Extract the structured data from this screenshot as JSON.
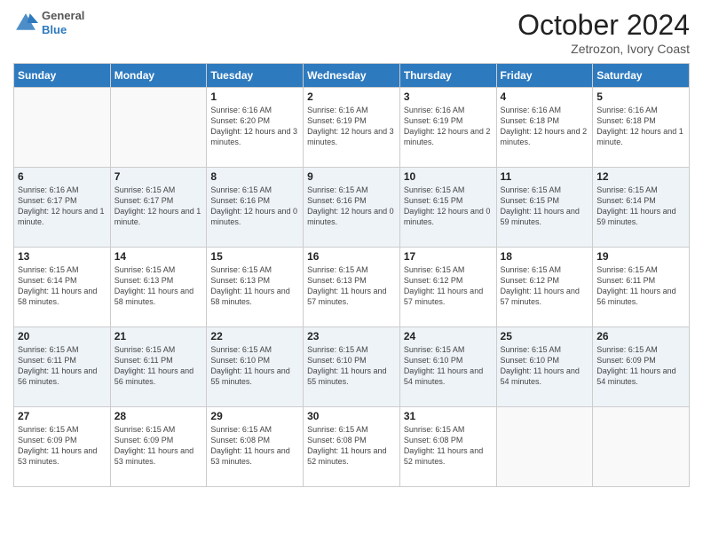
{
  "logo": {
    "line1": "General",
    "line2": "Blue"
  },
  "title": "October 2024",
  "subtitle": "Zetrozon, Ivory Coast",
  "weekdays": [
    "Sunday",
    "Monday",
    "Tuesday",
    "Wednesday",
    "Thursday",
    "Friday",
    "Saturday"
  ],
  "weeks": [
    [
      {
        "day": "",
        "info": ""
      },
      {
        "day": "",
        "info": ""
      },
      {
        "day": "1",
        "info": "Sunrise: 6:16 AM\nSunset: 6:20 PM\nDaylight: 12 hours and 3 minutes."
      },
      {
        "day": "2",
        "info": "Sunrise: 6:16 AM\nSunset: 6:19 PM\nDaylight: 12 hours and 3 minutes."
      },
      {
        "day": "3",
        "info": "Sunrise: 6:16 AM\nSunset: 6:19 PM\nDaylight: 12 hours and 2 minutes."
      },
      {
        "day": "4",
        "info": "Sunrise: 6:16 AM\nSunset: 6:18 PM\nDaylight: 12 hours and 2 minutes."
      },
      {
        "day": "5",
        "info": "Sunrise: 6:16 AM\nSunset: 6:18 PM\nDaylight: 12 hours and 1 minute."
      }
    ],
    [
      {
        "day": "6",
        "info": "Sunrise: 6:16 AM\nSunset: 6:17 PM\nDaylight: 12 hours and 1 minute."
      },
      {
        "day": "7",
        "info": "Sunrise: 6:15 AM\nSunset: 6:17 PM\nDaylight: 12 hours and 1 minute."
      },
      {
        "day": "8",
        "info": "Sunrise: 6:15 AM\nSunset: 6:16 PM\nDaylight: 12 hours and 0 minutes."
      },
      {
        "day": "9",
        "info": "Sunrise: 6:15 AM\nSunset: 6:16 PM\nDaylight: 12 hours and 0 minutes."
      },
      {
        "day": "10",
        "info": "Sunrise: 6:15 AM\nSunset: 6:15 PM\nDaylight: 12 hours and 0 minutes."
      },
      {
        "day": "11",
        "info": "Sunrise: 6:15 AM\nSunset: 6:15 PM\nDaylight: 11 hours and 59 minutes."
      },
      {
        "day": "12",
        "info": "Sunrise: 6:15 AM\nSunset: 6:14 PM\nDaylight: 11 hours and 59 minutes."
      }
    ],
    [
      {
        "day": "13",
        "info": "Sunrise: 6:15 AM\nSunset: 6:14 PM\nDaylight: 11 hours and 58 minutes."
      },
      {
        "day": "14",
        "info": "Sunrise: 6:15 AM\nSunset: 6:13 PM\nDaylight: 11 hours and 58 minutes."
      },
      {
        "day": "15",
        "info": "Sunrise: 6:15 AM\nSunset: 6:13 PM\nDaylight: 11 hours and 58 minutes."
      },
      {
        "day": "16",
        "info": "Sunrise: 6:15 AM\nSunset: 6:13 PM\nDaylight: 11 hours and 57 minutes."
      },
      {
        "day": "17",
        "info": "Sunrise: 6:15 AM\nSunset: 6:12 PM\nDaylight: 11 hours and 57 minutes."
      },
      {
        "day": "18",
        "info": "Sunrise: 6:15 AM\nSunset: 6:12 PM\nDaylight: 11 hours and 57 minutes."
      },
      {
        "day": "19",
        "info": "Sunrise: 6:15 AM\nSunset: 6:11 PM\nDaylight: 11 hours and 56 minutes."
      }
    ],
    [
      {
        "day": "20",
        "info": "Sunrise: 6:15 AM\nSunset: 6:11 PM\nDaylight: 11 hours and 56 minutes."
      },
      {
        "day": "21",
        "info": "Sunrise: 6:15 AM\nSunset: 6:11 PM\nDaylight: 11 hours and 56 minutes."
      },
      {
        "day": "22",
        "info": "Sunrise: 6:15 AM\nSunset: 6:10 PM\nDaylight: 11 hours and 55 minutes."
      },
      {
        "day": "23",
        "info": "Sunrise: 6:15 AM\nSunset: 6:10 PM\nDaylight: 11 hours and 55 minutes."
      },
      {
        "day": "24",
        "info": "Sunrise: 6:15 AM\nSunset: 6:10 PM\nDaylight: 11 hours and 54 minutes."
      },
      {
        "day": "25",
        "info": "Sunrise: 6:15 AM\nSunset: 6:10 PM\nDaylight: 11 hours and 54 minutes."
      },
      {
        "day": "26",
        "info": "Sunrise: 6:15 AM\nSunset: 6:09 PM\nDaylight: 11 hours and 54 minutes."
      }
    ],
    [
      {
        "day": "27",
        "info": "Sunrise: 6:15 AM\nSunset: 6:09 PM\nDaylight: 11 hours and 53 minutes."
      },
      {
        "day": "28",
        "info": "Sunrise: 6:15 AM\nSunset: 6:09 PM\nDaylight: 11 hours and 53 minutes."
      },
      {
        "day": "29",
        "info": "Sunrise: 6:15 AM\nSunset: 6:08 PM\nDaylight: 11 hours and 53 minutes."
      },
      {
        "day": "30",
        "info": "Sunrise: 6:15 AM\nSunset: 6:08 PM\nDaylight: 11 hours and 52 minutes."
      },
      {
        "day": "31",
        "info": "Sunrise: 6:15 AM\nSunset: 6:08 PM\nDaylight: 11 hours and 52 minutes."
      },
      {
        "day": "",
        "info": ""
      },
      {
        "day": "",
        "info": ""
      }
    ]
  ]
}
